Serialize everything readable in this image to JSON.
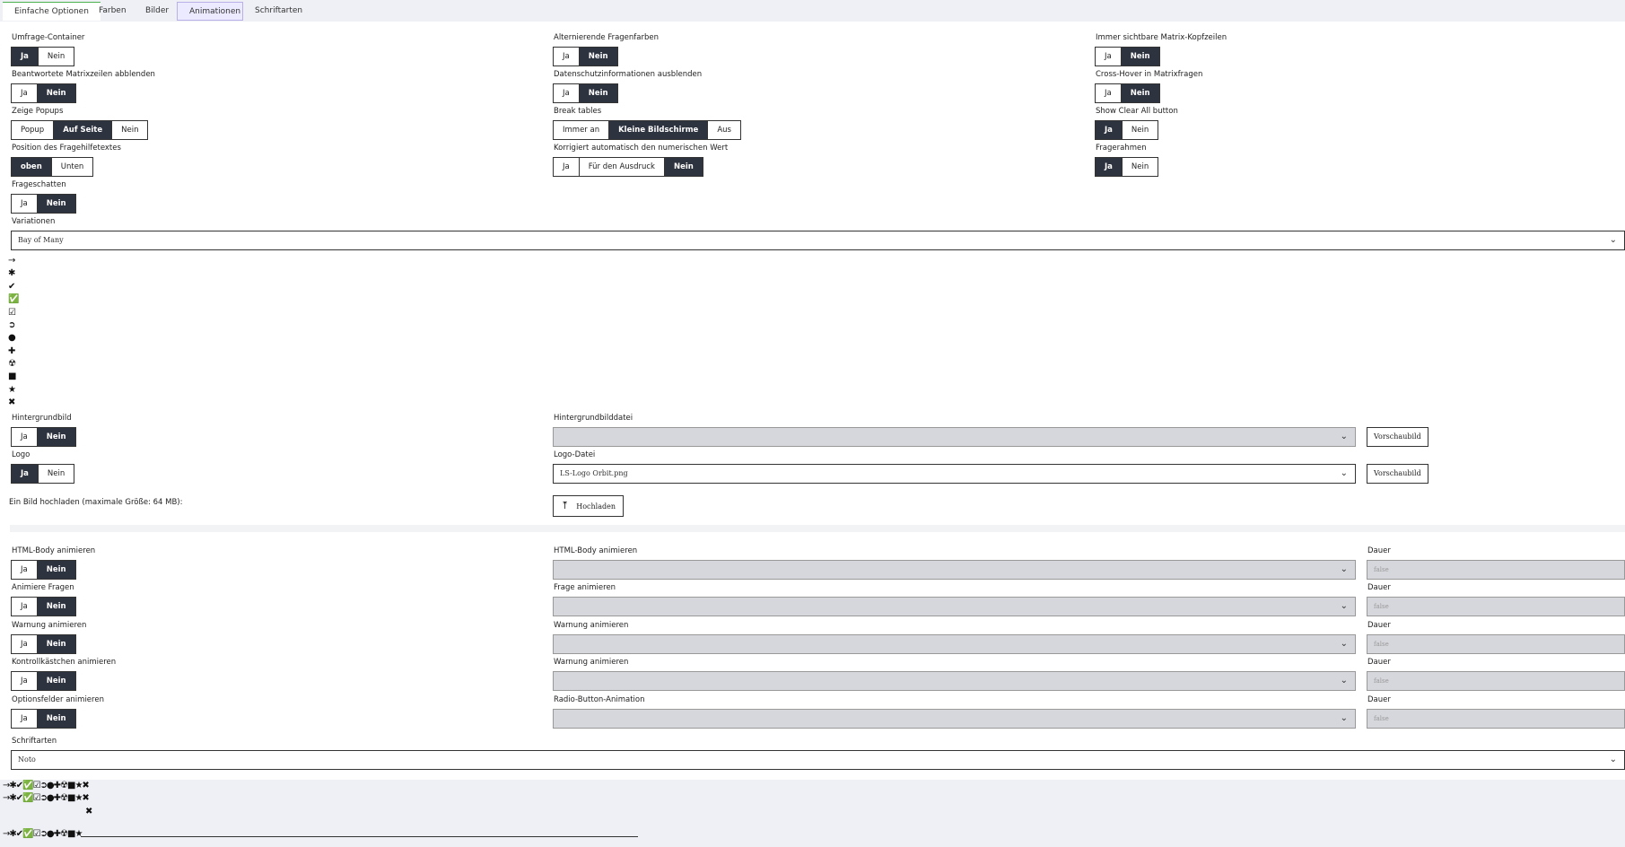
{
  "tabs": [
    "Einfache Optionen",
    "Farben",
    "Bilder",
    "Animationen",
    "Schriftarten"
  ],
  "fields": {
    "umfrage_container": {
      "label": "Umfrage-Container",
      "options": [
        "Ja",
        "Nein"
      ]
    },
    "alternierende": {
      "label": "Alternierende Fragenfarben",
      "options": [
        "Ja",
        "Nein"
      ]
    },
    "matrix_kopf": {
      "label": "Immer sichtbare Matrix-Kopfzeilen",
      "options": [
        "Ja",
        "Nein"
      ]
    },
    "beantwortete": {
      "label": "Beantwortete Matrixzeilen abblenden",
      "options": [
        "Ja",
        "Nein"
      ]
    },
    "datenschutz": {
      "label": "Datenschutzinformationen ausblenden",
      "options": [
        "Ja",
        "Nein"
      ]
    },
    "cross_hover": {
      "label": "Cross-Hover in Matrixfragen",
      "options": [
        "Ja",
        "Nein"
      ]
    },
    "popups": {
      "label": "Zeige Popups",
      "options": [
        "Popup",
        "Auf Seite",
        "Nein"
      ]
    },
    "break_tables": {
      "label": "Break tables",
      "options": [
        "Immer an",
        "Kleine Bildschirme",
        "Aus"
      ]
    },
    "clear_all": {
      "label": "Show Clear All button",
      "options": [
        "Ja",
        "Nein"
      ]
    },
    "hilfetext_pos": {
      "label": "Position des Fragehilfetextes",
      "options": [
        "oben",
        "Unten"
      ]
    },
    "korrigiert": {
      "label": "Korrigiert automatisch den numerischen Wert",
      "options": [
        "Ja",
        "Für den Ausdruck",
        "Nein"
      ]
    },
    "fragerahmen": {
      "label": "Fragerahmen",
      "options": [
        "Ja",
        "Nein"
      ]
    },
    "frageschatten": {
      "label": "Frageschatten",
      "options": [
        "Ja",
        "Nein"
      ]
    },
    "variationen": {
      "label": "Variationen",
      "value": "Bay of Many"
    }
  },
  "icons": [
    "→",
    "✱",
    "✔",
    "✅",
    "☑",
    "➲",
    "●",
    "✚",
    "☢",
    "■",
    "★",
    "✖"
  ],
  "images": {
    "hintergrundbild": {
      "label": "Hintergrundbild",
      "options": [
        "Ja",
        "Nein"
      ]
    },
    "hintergrunddatei": {
      "label": "Hintergrundbilddatei",
      "value": ""
    },
    "logo": {
      "label": "Logo",
      "options": [
        "Ja",
        "Nein"
      ]
    },
    "logo_datei": {
      "label": "Logo-Datei",
      "value": "LS-Logo Orbit.png"
    },
    "preview": "Vorschaubild",
    "upload_label": "Ein Bild hochladen (maximale Größe: 64 MB):",
    "upload_button": "Hochladen"
  },
  "animations": [
    {
      "label": "HTML-Body animieren",
      "select_label": "HTML-Body animieren"
    },
    {
      "label": "Animiere Fragen",
      "select_label": "Frage animieren"
    },
    {
      "label": "Warnung animieren",
      "select_label": "Warnung animieren"
    },
    {
      "label": "Kontrollkästchen animieren",
      "select_label": "Warnung animieren"
    },
    {
      "label": "Optionsfelder animieren",
      "select_label": "Radio-Button-Animation"
    }
  ],
  "anim_options": [
    "Ja",
    "Nein"
  ],
  "dauer_label": "Dauer",
  "dauer_value": "false",
  "fonts": {
    "label": "Schriftarten",
    "value": "Noto"
  },
  "bottom_icons": "→✱✔✅☑➲●✚☢■★✖",
  "bottom_icons_short": "→✱✔✅☑➲●✚☢■★",
  "bottom_x": "✖"
}
